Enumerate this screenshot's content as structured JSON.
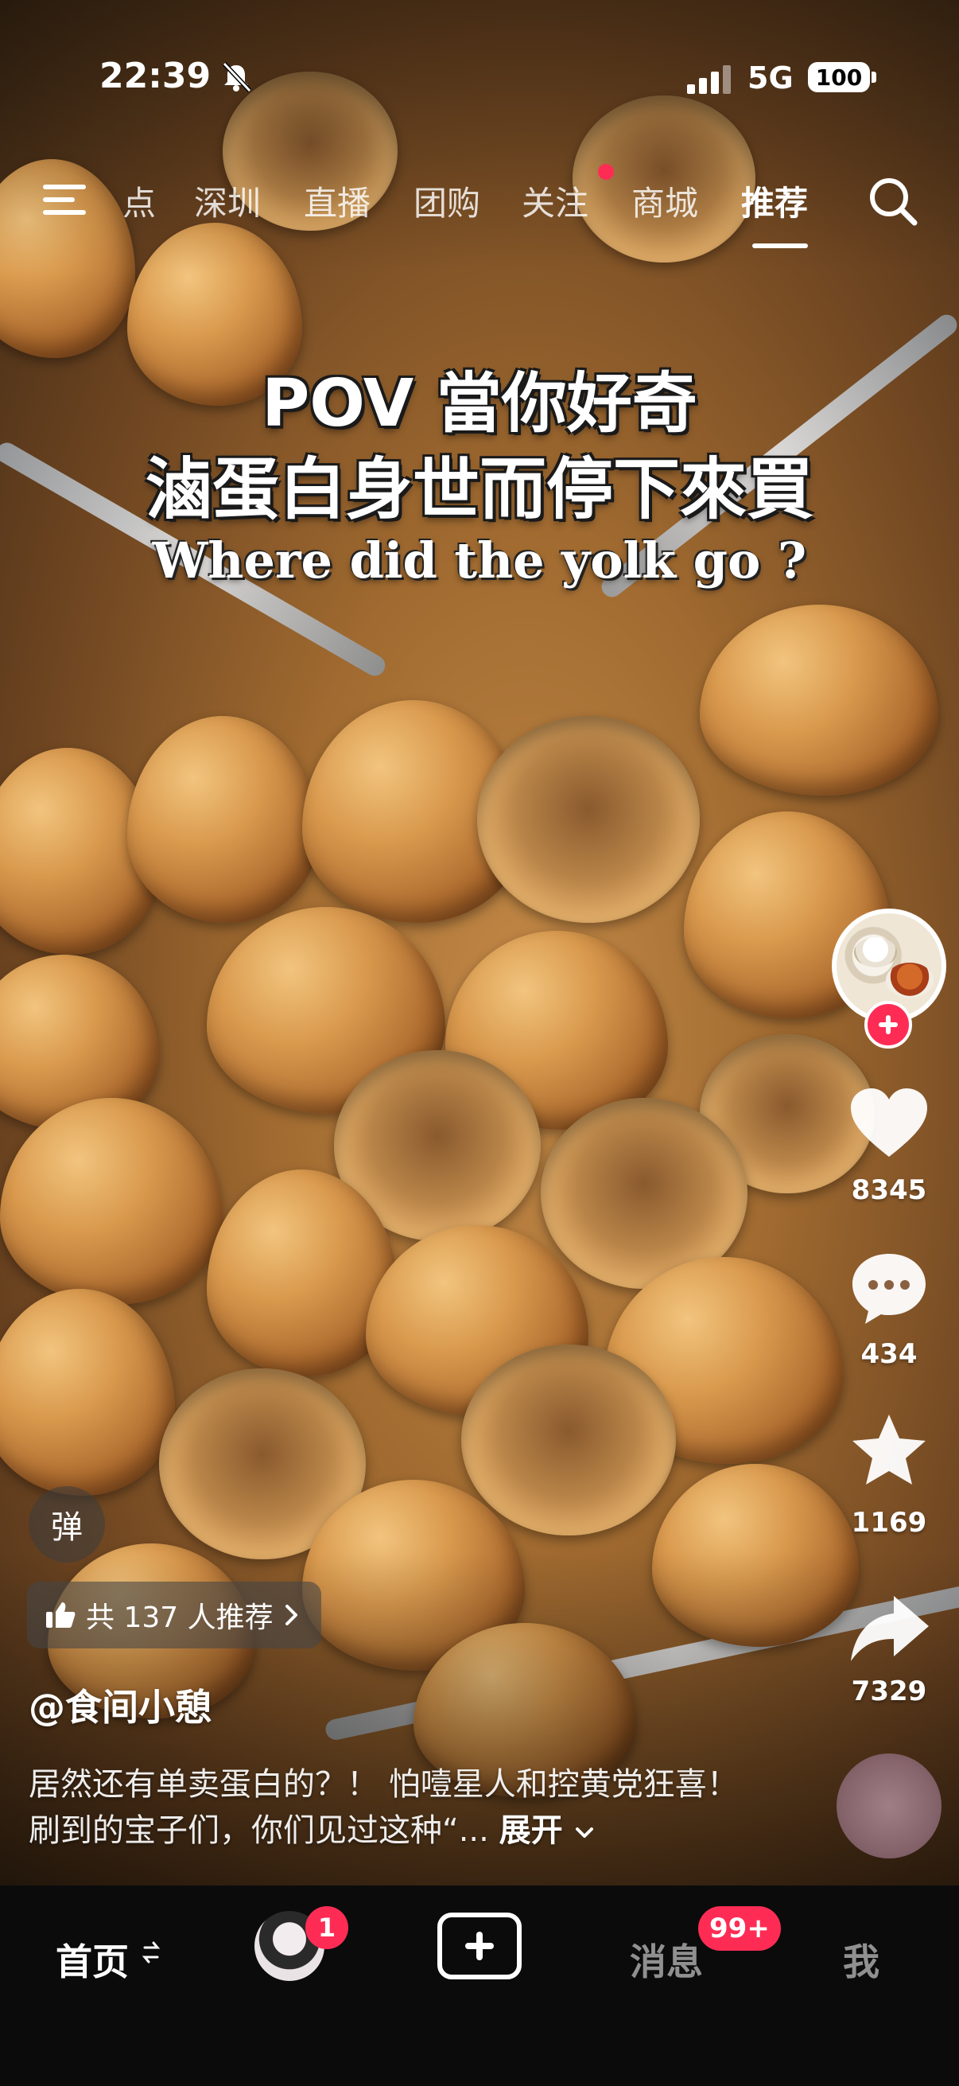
{
  "status_bar": {
    "time": "22:39",
    "network": "5G",
    "battery": "100"
  },
  "top_nav": {
    "tabs": [
      {
        "label": "点"
      },
      {
        "label": "深圳"
      },
      {
        "label": "直播"
      },
      {
        "label": "团购"
      },
      {
        "label": "关注",
        "has_dot": true
      },
      {
        "label": "商城"
      },
      {
        "label": "推荐",
        "active": true
      }
    ]
  },
  "video": {
    "caption_line1": "POV 當你好奇",
    "caption_line2": "滷蛋白身世而停下來買",
    "caption_line3": "Where did the yolk go ?"
  },
  "actions": {
    "likes": "8345",
    "comments": "434",
    "favorites": "1169",
    "shares": "7329"
  },
  "danmaku_label": "弹",
  "recommend": {
    "label": "共 137 人推荐"
  },
  "post": {
    "author": "@食间小憩",
    "description": "居然还有单卖蛋白的？！ 怕噎星人和控黄党狂喜！ 刷到的宝子们，你们见过这种“...",
    "expand_label": "展开"
  },
  "bottom_bar": {
    "home_label": "首页",
    "friend_badge": "1",
    "messages_label": "消息",
    "messages_badge": "99+",
    "me_label": "我"
  },
  "colors": {
    "accent": "#fe2c55",
    "tabbar_bg": "#0b0b0b"
  }
}
